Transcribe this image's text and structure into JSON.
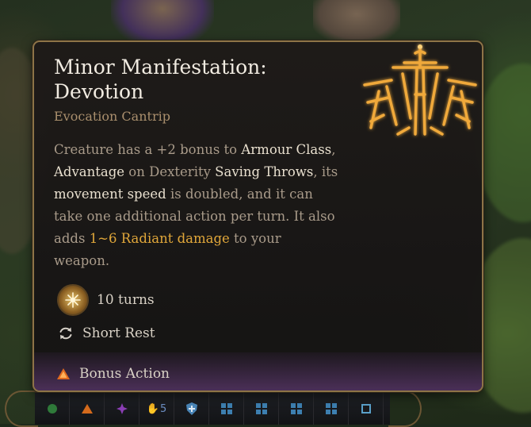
{
  "spell": {
    "name": "Minor Manifestation: Devotion",
    "school": "Evocation Cantrip",
    "description": [
      {
        "text": "Creature has a +2 bonus to ",
        "style": "plain"
      },
      {
        "text": "Armour Class",
        "style": "kw"
      },
      {
        "text": ", ",
        "style": "plain"
      },
      {
        "text": "Advantage",
        "style": "kw"
      },
      {
        "text": " on Dexterity ",
        "style": "plain"
      },
      {
        "text": "Saving Throws",
        "style": "kw"
      },
      {
        "text": ", its ",
        "style": "plain"
      },
      {
        "text": "movement speed",
        "style": "kw"
      },
      {
        "text": " is doubled, and it can take one additional action per turn. It also adds ",
        "style": "plain"
      },
      {
        "text": "1~6 Radiant damage",
        "style": "dmg"
      },
      {
        "text": " to your weapon.",
        "style": "plain"
      }
    ],
    "duration": {
      "icon": "sun-burst-icon",
      "label": "10 turns"
    },
    "recharge": {
      "icon": "short-rest-cycle-icon",
      "label": "Short Rest"
    },
    "cost": {
      "icon": "bonus-action-triangle-icon",
      "label": "Bonus Action"
    },
    "emblem_icon": "radiant-deity-emblem-icon"
  },
  "hotbar": {
    "slots": [
      {
        "icon": "action-circle-icon",
        "color": "#2f7a3a"
      },
      {
        "icon": "bonus-action-triangle-icon",
        "color": "#d46a1c"
      },
      {
        "icon": "spell-slot-star-icon",
        "color": "#8b3fb5"
      },
      {
        "icon": "hand-counter-icon",
        "label": "5",
        "color": "#6d8fc4"
      },
      {
        "icon": "shield-cross-icon",
        "color": "#4a86b8"
      },
      {
        "icon": "grid-icon",
        "color": "#3d7fb0"
      },
      {
        "icon": "grid-icon",
        "color": "#3d7fb0"
      },
      {
        "icon": "grid-icon",
        "color": "#3d7fb0"
      },
      {
        "icon": "grid-icon",
        "color": "#3d7fb0"
      },
      {
        "icon": "small-square-icon",
        "color": "#5aa0c9"
      }
    ]
  },
  "colors": {
    "gold_accent": "#e1a73a",
    "border": "#8d7447",
    "keyword": "#e9e0cf",
    "body_text": "#a99b8a"
  }
}
